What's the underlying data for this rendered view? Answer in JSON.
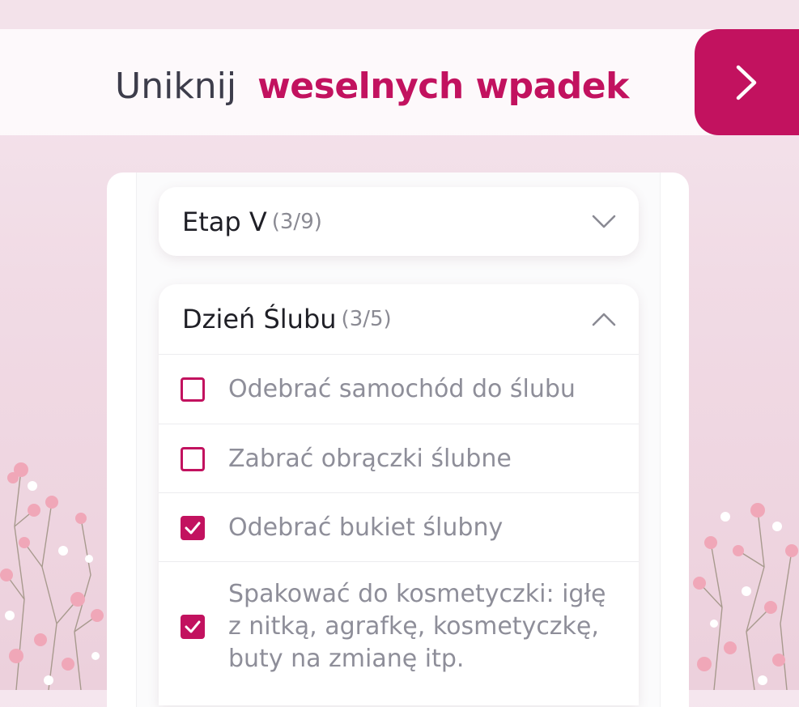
{
  "banner": {
    "title_plain": "Uniknij",
    "title_accent": "weselnych wpadek",
    "next_icon": "chevron-right-icon"
  },
  "colors": {
    "accent": "#c2125f",
    "text_dark": "#1f1f26",
    "text_muted": "#8e8e99",
    "background": "#f1dbe5"
  },
  "sections": [
    {
      "title": "Etap V",
      "count": "(3/9)",
      "expanded": false,
      "chevron_icon": "chevron-down-icon"
    },
    {
      "title": "Dzień Ślubu",
      "count": "(3/5)",
      "expanded": true,
      "chevron_icon": "chevron-up-icon",
      "items": [
        {
          "label": "Odebrać samochód do ślubu",
          "checked": false
        },
        {
          "label": "Zabrać obrączki ślubne",
          "checked": false
        },
        {
          "label": "Odebrać bukiet ślubny",
          "checked": true
        },
        {
          "label_lines": [
            "Spakować do kosmetyczki: igłę",
            "z nitką, agrafkę, kosmetyczkę,",
            "buty na zmianę itp."
          ],
          "checked": true
        }
      ]
    }
  ]
}
